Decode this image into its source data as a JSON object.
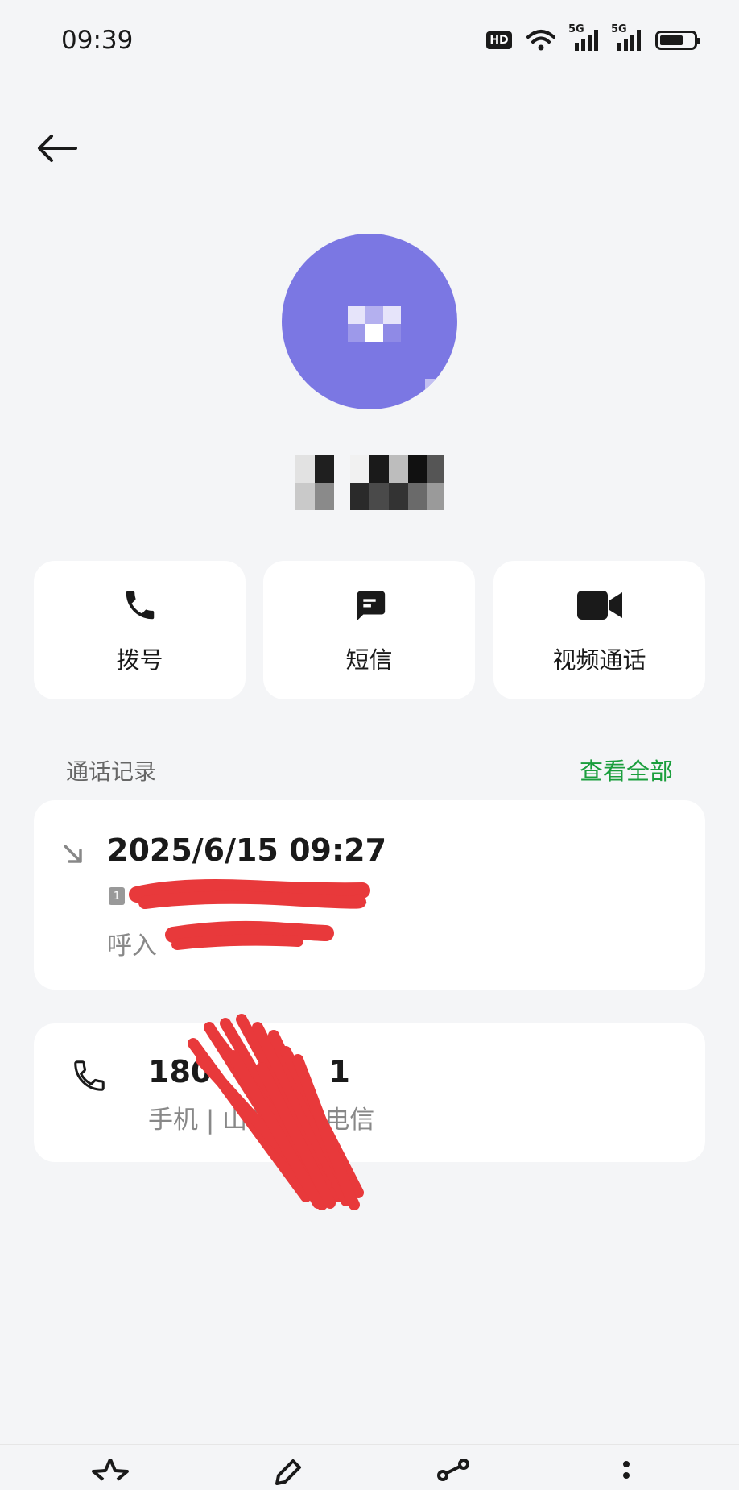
{
  "status_bar": {
    "time": "09:39",
    "hd_label": "HD",
    "network_label": "5G",
    "battery_level": 0.7
  },
  "actions": [
    {
      "label": "拨号",
      "icon": "phone-icon"
    },
    {
      "label": "短信",
      "icon": "message-icon"
    },
    {
      "label": "视频通话",
      "icon": "video-camera-icon"
    }
  ],
  "call_log": {
    "title": "通话记录",
    "view_all": "查看全部",
    "entry": {
      "datetime": "2025/6/15 09:27",
      "sim_label": "1",
      "sim_text": "1",
      "type": "呼入",
      "direction_icon": "incoming-call-arrow-icon"
    }
  },
  "phone_number": {
    "number": "180 ⠀⠀⠀⠀ 1",
    "meta": "手机 | 山东 ⠀⠀ 电信",
    "icon": "phone-outline-icon"
  },
  "bottom_bar": {
    "icons": [
      "star-icon",
      "edit-icon",
      "share-icon",
      "more-icon"
    ]
  },
  "colors": {
    "accent_green": "#1a9e3c",
    "avatar": "#7b77e3",
    "redaction": "#e8393b"
  }
}
